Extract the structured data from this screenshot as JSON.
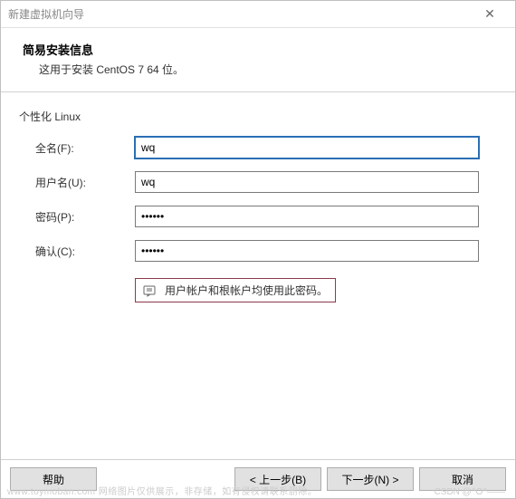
{
  "titlebar": {
    "title": "新建虚拟机向导"
  },
  "header": {
    "title": "简易安装信息",
    "subtitle": "这用于安装 CentOS 7 64 位。"
  },
  "section": {
    "title": "个性化 Linux"
  },
  "form": {
    "fullname_label": "全名(F):",
    "fullname_value": "wq",
    "username_label": "用户名(U):",
    "username_value": "wq",
    "password_label": "密码(P):",
    "password_value": "••••••",
    "confirm_label": "确认(C):",
    "confirm_value": "••••••"
  },
  "notice": {
    "text": "用户帐户和根帐户均使用此密码。"
  },
  "footer": {
    "help": "帮助",
    "back": "< 上一步(B)",
    "next": "下一步(N) >",
    "cancel": "取消"
  },
  "watermark": {
    "left": "www.toymoban.com 网络图片仅供展示，非存储，如有侵权请联系删除。",
    "right": "CSDN @^O^——"
  }
}
